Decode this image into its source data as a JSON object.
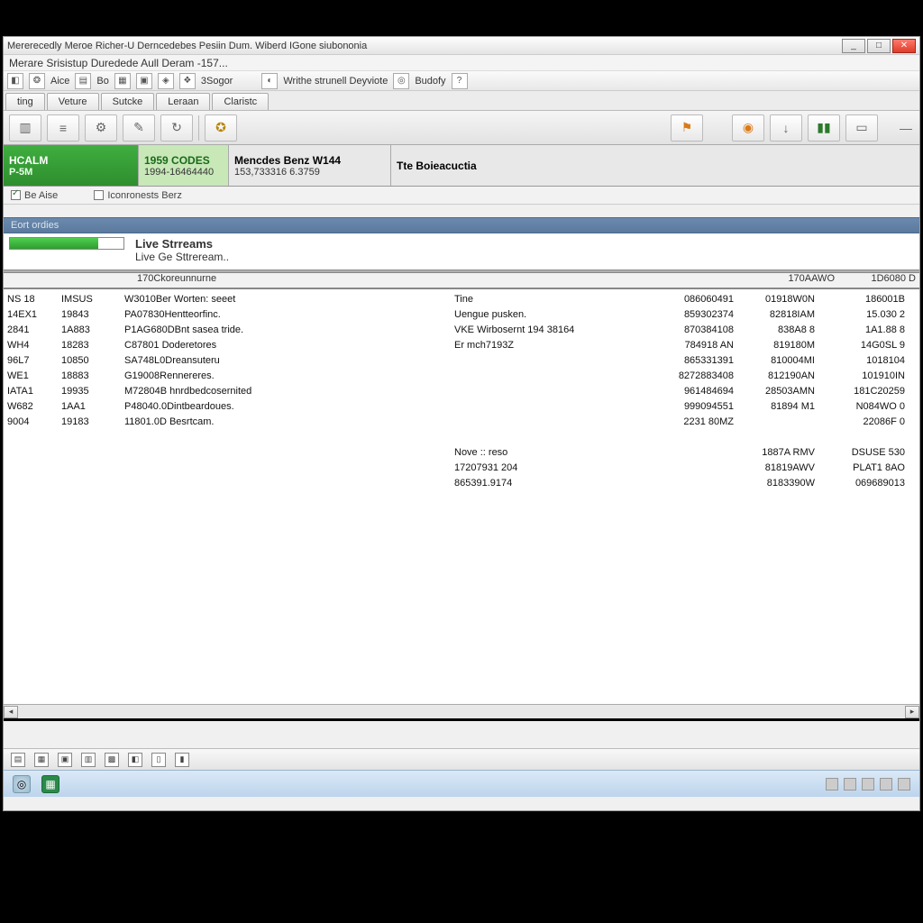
{
  "titlebar": "Mererecedly Meroe Richer-U Derncedebes Pesiin Dum. Wiberd IGone siubononia",
  "subtitle": "Merare Srisistup Duredede Aull Deram  -157...",
  "toolbar": {
    "items": [
      "Aice",
      "Bo",
      "3Sogor",
      "Writhe strunell Deyviote",
      "Budofy"
    ]
  },
  "tabs": [
    "ting",
    "Veture",
    "Sutcke",
    "Leraan",
    "Claristc"
  ],
  "info": {
    "hcalm": {
      "top": "HCALM",
      "bot": "P-5M"
    },
    "codes": {
      "top": "1959 CODES",
      "bot": "1994-16464440"
    },
    "model": {
      "top": "Mencdes Benz W144",
      "bot": "153,733316 6.3759"
    },
    "extra": "Tte Boieacuctia"
  },
  "subinfo": {
    "left": "Be   Aise",
    "right": "Iconronests Berz"
  },
  "sectionbar": "Eort ordies",
  "livestreams": {
    "title": "Live Strreams",
    "sub": "Live Ge Sttreream.."
  },
  "headers": {
    "left": "170Ckoreunnurne",
    "r2": "170AAWO",
    "r3": "1D6080 D"
  },
  "left_rows": [
    {
      "c1": "NS 18",
      "c2": "IMSUS",
      "c3": "W3010Ber Worten:  seeet"
    },
    {
      "c1": "14EX1",
      "c2": "19843",
      "c3": "PA07830Hentteorfinc."
    },
    {
      "c1": "2841",
      "c2": "1A883",
      "c3": "P1AG680DBnt sasea tride."
    },
    {
      "c1": "WH4",
      "c2": "18283",
      "c3": "C87801 Doderetores"
    },
    {
      "c1": "96L7",
      "c2": "10850",
      "c3": "SA748L0Dreansuteru"
    },
    {
      "c1": "WE1",
      "c2": "18883",
      "c3": "G19008Rennereres."
    },
    {
      "c1": "IATA1",
      "c2": "19935",
      "c3": "M72804B hnrdbedcosernited"
    },
    {
      "c1": "W682",
      "c2": "1AA1",
      "c3": "P48040.0Dintbeardoues."
    },
    {
      "c1": "9004",
      "c2": "19183",
      "c3": "11801.0D Besrtcam."
    }
  ],
  "right_rows": [
    {
      "r1": "Tine",
      "r2": "086060491",
      "r3": "01918W0N",
      "r4": "186001B"
    },
    {
      "r1": "Uengue pusken.",
      "r2": "859302374",
      "r3": "82818IAM",
      "r4": "15.030 2"
    },
    {
      "r1": "VKE Wirbosernt 194 38164",
      "r2": "870384108",
      "r3": "838A8 8",
      "r4": "1A1.88 8"
    },
    {
      "r1": "Er mch7193Z",
      "r2": "784918 AN",
      "r3": "819180M",
      "r4": "14G0SL 9"
    },
    {
      "r1": "",
      "r2": "865331391",
      "r3": "810004MI",
      "r4": "1018104"
    },
    {
      "r1": "",
      "r2": "8272883408",
      "r3": "812190AN",
      "r4": "101910IN"
    },
    {
      "r1": "",
      "r2": "961484694",
      "r3": "28503AMN",
      "r4": "181C20259"
    },
    {
      "r1": "",
      "r2": "999094551",
      "r3": "81894 M1",
      "r4": "N084WO  0"
    },
    {
      "r1": "",
      "r2": "2231 80MZ",
      "r3": "",
      "r4": "22086F  0"
    },
    {
      "r1": "",
      "r2": "",
      "r3": "",
      "r4": ""
    },
    {
      "r1": "Nove :: reso",
      "r2": "",
      "r3": "1887A RMV",
      "r4": "DSUSE 530"
    },
    {
      "r1": "17207931 204",
      "r2": "",
      "r3": "81819AWV",
      "r4": "PLAT1 8AO"
    },
    {
      "r1": "865391.9174",
      "r2": "",
      "r3": "8183390W",
      "r4": "069689013"
    }
  ]
}
